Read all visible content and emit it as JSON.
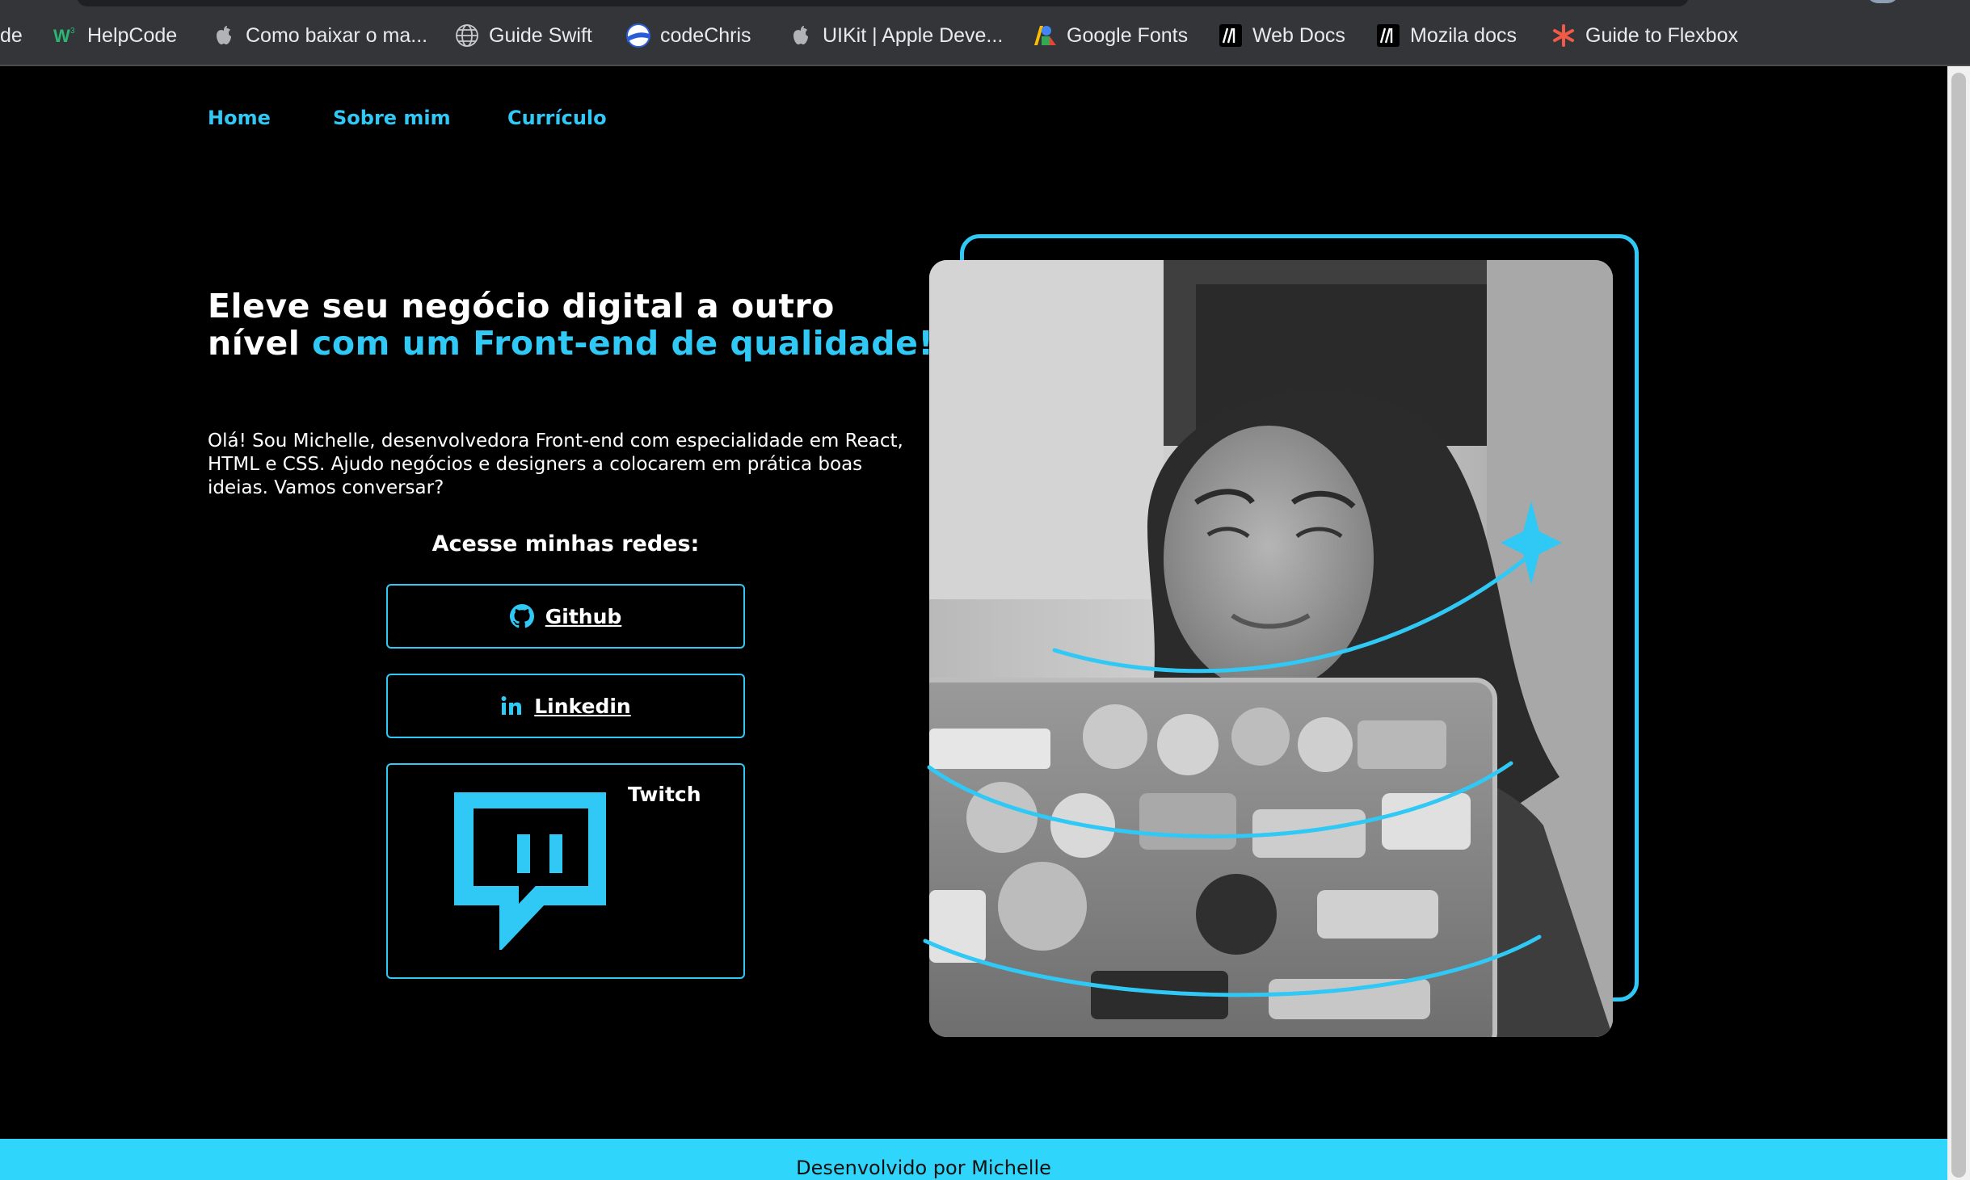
{
  "bookmarks": [
    {
      "label": "de",
      "icon": "none"
    },
    {
      "label": "HelpCode",
      "icon": "w3-icon"
    },
    {
      "label": "Como baixar o ma...",
      "icon": "apple-icon"
    },
    {
      "label": "Guide Swift",
      "icon": "globe-icon"
    },
    {
      "label": "codeChris",
      "icon": "codechris-icon"
    },
    {
      "label": "UIKit | Apple Deve...",
      "icon": "apple-icon"
    },
    {
      "label": "Google Fonts",
      "icon": "google-fonts-icon"
    },
    {
      "label": "Web Docs",
      "icon": "mdn-icon"
    },
    {
      "label": "Mozila docs",
      "icon": "mdn-icon"
    },
    {
      "label": "Guide to Flexbox",
      "icon": "css-tricks-icon"
    }
  ],
  "nav": {
    "items": [
      "Home",
      "Sobre mim",
      "Currículo"
    ]
  },
  "hero": {
    "headline_white": "Eleve seu negócio digital a outro nível",
    "headline_accent": "com um Front-end de qualidade!",
    "intro": "Olá! Sou Michelle, desenvolvedora Front-end com especialidade em React, HTML e CSS. Ajudo negócios e designers a colocarem em prática boas ideias. Vamos conversar?",
    "social_title": "Acesse minhas redes:",
    "buttons": [
      {
        "label": "Github",
        "icon": "github-icon"
      },
      {
        "label": "Linkedin",
        "icon": "linkedin-icon"
      },
      {
        "label": "Twitch",
        "icon": "twitch-icon"
      }
    ]
  },
  "footer": {
    "text": "Desenvolvido por Michelle"
  },
  "colors": {
    "accent": "#30c9f5",
    "background": "#000000",
    "footer_bg": "#30d5fb",
    "bookmarks_bar": "#333538"
  }
}
